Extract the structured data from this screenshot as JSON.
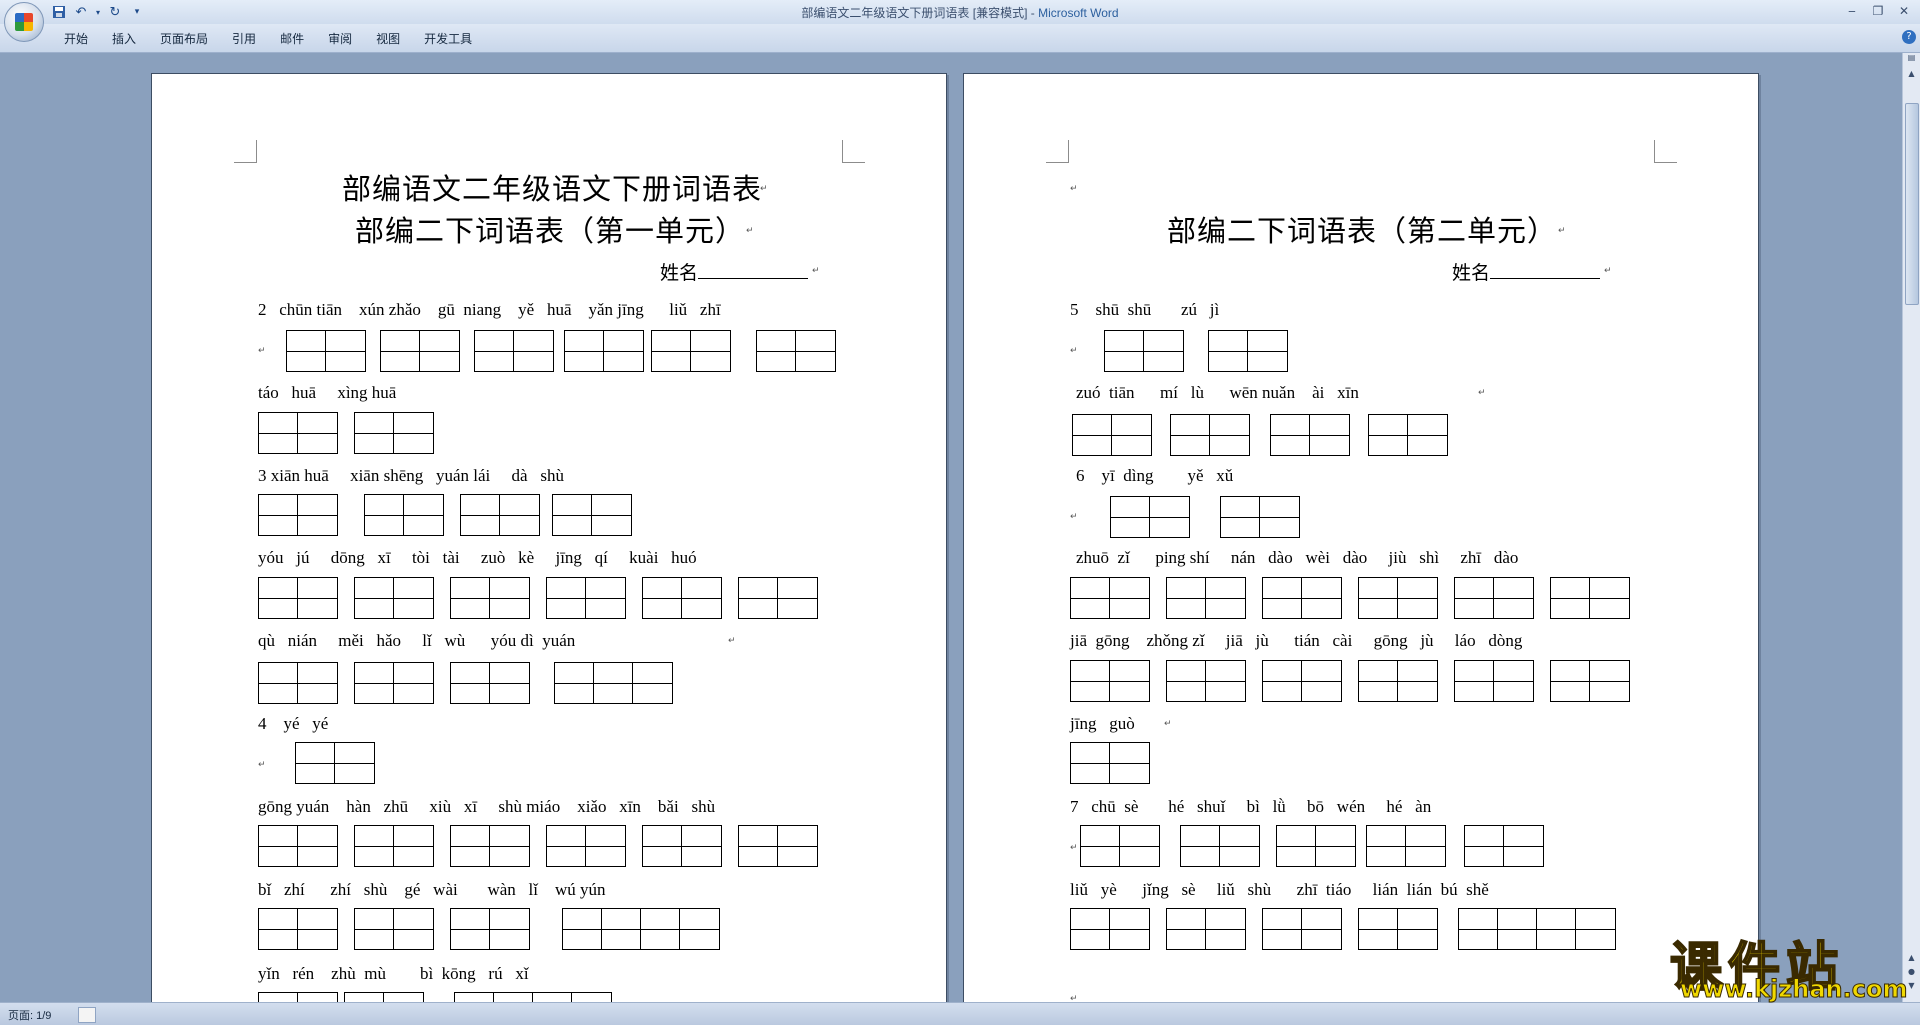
{
  "window": {
    "title_doc": "部编语文二年级语文下册词语表 [兼容模式]",
    "title_sep": " - ",
    "title_app": "Microsoft Word"
  },
  "qat": {
    "save_icon": "save-icon",
    "undo_icon": "undo-icon",
    "redo_icon": "redo-icon",
    "customize": "▾"
  },
  "ribbon": {
    "tabs": [
      "开始",
      "插入",
      "页面布局",
      "引用",
      "邮件",
      "审阅",
      "视图",
      "开发工具"
    ]
  },
  "page1": {
    "title1": "部编语文二年级语文下册词语表",
    "title2": "部编二下词语表（第一单元）",
    "name_label": "姓名",
    "lines": [
      "2   chūn tiān    xún zhǎo    gū  niang    yě   huā    yǎn jīng      liǔ   zhī",
      "táo   huā     xìng huā",
      "3 xiān huā     xiān shēng   yuán lái     dà   shù",
      "yóu   jú     dōng   xī     tòi   tài     zuò   kè     jīng   qí     kuài   huó",
      "qù   nián     měi   hǎo     lǐ   wù      yóu dì  yuán",
      "4    yé   yé",
      "gōng yuán    hàn   zhū     xiù   xī     shù miáo    xiǎo   xīn    bǎi   shù",
      "bǐ   zhí      zhí   shù    gé   wài       wàn   lǐ    wú yún",
      "yǐn   rén    zhù  mù        bì  kōng   rú   xǐ"
    ]
  },
  "page2": {
    "title2": "部编二下词语表（第二单元）",
    "name_label": "姓名",
    "lines": [
      "5    shū  shū       zú   jì",
      "zuó  tiān      mí   lù      wēn nuǎn    ài   xīn",
      "6    yī  dìng        yě   xǔ",
      "zhuō  zǐ      ping shí     nán   dào   wèi   dào     jiù   shì     zhī   dào",
      "jiā  gōng    zhǒng zǐ     jiā   jù      tián   cài     gōng   jù     láo   dòng",
      "jīng   guò",
      "7   chū  sè       hé   shuǐ     bì   lǜ     bō   wén     hé   àn",
      "liǔ   yè      jǐng   sè     liǔ   shù      zhī  tiáo     lián  lián  bú  shě"
    ]
  },
  "status": {
    "page": "页面: 1/9"
  },
  "watermark": {
    "main": "课件站",
    "url": "www.kjzhan.com"
  },
  "colors": {
    "doc_bg": "#8aa0bd",
    "watermark": "#f0d800",
    "ribbon": "#dfe8f5"
  }
}
